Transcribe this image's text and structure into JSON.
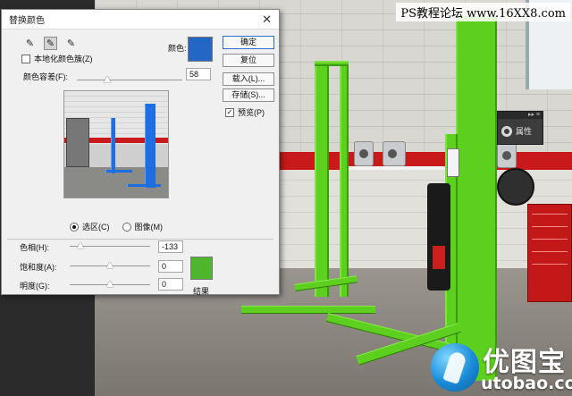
{
  "watermark": "PS教程论坛 www.16XX8.com",
  "logo": {
    "cn": "优图宝",
    "url": "utobao.com"
  },
  "properties_panel": {
    "top_glyphs": "▸▸ ≡",
    "label": "属性"
  },
  "dialog": {
    "title": "替换颜色",
    "close": "✕",
    "tools": [
      {
        "name": "eyedropper",
        "glyph": "✎"
      },
      {
        "name": "eyedropper-add",
        "glyph": "✎"
      },
      {
        "name": "eyedropper-subtract",
        "glyph": "✎"
      }
    ],
    "localized_label": "本地化颜色簇(Z)",
    "localized_checked": false,
    "color_label": "颜色:",
    "selection_color": "#2466c6",
    "fuzziness_label": "颜色容差(F):",
    "fuzziness_value": "58",
    "fuzziness_fraction": 0.29,
    "radio_selection": "选区(C)",
    "radio_image": "图像(M)",
    "selected_mode": "selection",
    "hue_label": "色相(H):",
    "hue_value": "-133",
    "hue_fraction": 0.13,
    "saturation_label": "饱和度(A):",
    "saturation_value": "0",
    "saturation_fraction": 0.5,
    "lightness_label": "明度(G):",
    "lightness_value": "0",
    "lightness_fraction": 0.5,
    "result_color": "#4fb52c",
    "result_label": "结果",
    "buttons": {
      "ok": "确定",
      "reset": "复位",
      "load": "载入(L)...",
      "save": "存储(S)...",
      "preview": "预览(P)"
    },
    "preview_checked": true
  },
  "colors": {
    "lift_green": "#5ccf1f",
    "preview_blue": "#1f6ee0",
    "wall_red": "#c81a1a"
  }
}
